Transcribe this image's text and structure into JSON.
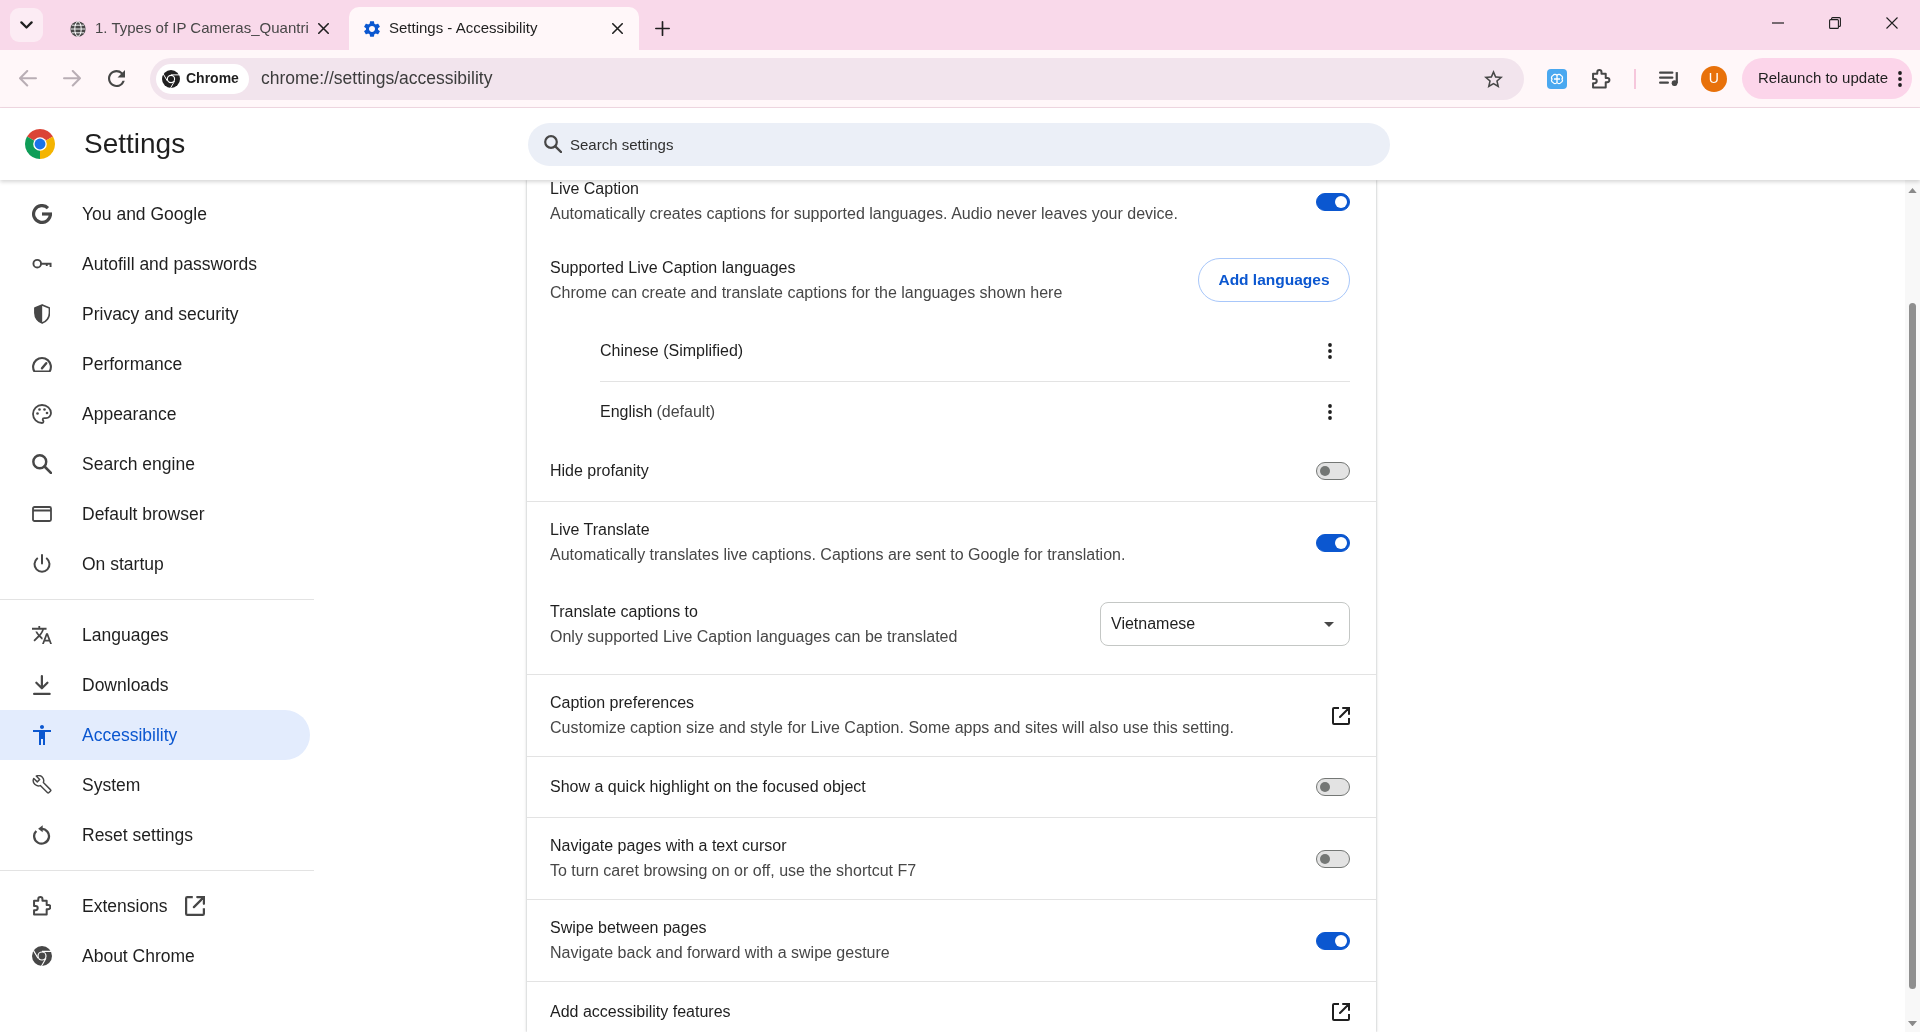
{
  "browser": {
    "tabs": [
      {
        "kind": "web",
        "title": "1. Types of IP Cameras_Quantri",
        "selected": false
      },
      {
        "kind": "settings",
        "title": "Settings - Accessibility",
        "selected": true
      }
    ],
    "toolbar": {
      "back_disabled": true,
      "forward_disabled": true,
      "site_chip": "Chrome",
      "url": "chrome://settings/accessibility",
      "avatar": "U",
      "relaunch_button": "Relaunch to update"
    }
  },
  "header": {
    "title": "Settings",
    "search": {
      "placeholder": "Search settings"
    }
  },
  "sidebar": {
    "groups": [
      {
        "items": [
          {
            "label": "You and Google",
            "selected": false,
            "external": false
          },
          {
            "label": "Autofill and passwords",
            "selected": false,
            "external": false
          },
          {
            "label": "Privacy and security",
            "selected": false,
            "external": false
          },
          {
            "label": "Performance",
            "selected": false,
            "external": false
          },
          {
            "label": "Appearance",
            "selected": false,
            "external": false
          },
          {
            "label": "Search engine",
            "selected": false,
            "external": false
          },
          {
            "label": "Default browser",
            "selected": false,
            "external": false
          },
          {
            "label": "On startup",
            "selected": false,
            "external": false
          }
        ]
      },
      {
        "items": [
          {
            "label": "Languages",
            "selected": false,
            "external": false
          },
          {
            "label": "Downloads",
            "selected": false,
            "external": false
          },
          {
            "label": "Accessibility",
            "selected": true,
            "external": false
          },
          {
            "label": "System",
            "selected": false,
            "external": false
          },
          {
            "label": "Reset settings",
            "selected": false,
            "external": false
          }
        ]
      },
      {
        "items": [
          {
            "label": "Extensions",
            "selected": false,
            "external": true
          },
          {
            "label": "About Chrome",
            "selected": false,
            "external": false
          }
        ]
      }
    ]
  },
  "content": {
    "sections": [
      {
        "rows": [
          {
            "kind": "toggle",
            "title": "Live Caption",
            "description": "Automatically creates captions for supported languages. Audio never leaves your device.",
            "on": true
          },
          {
            "kind": "languages",
            "title": "Supported Live Caption languages",
            "description": "Chrome can create and translate captions for the languages shown here",
            "button": "Add languages",
            "languages": [
              {
                "name": "Chinese (Simplified)"
              },
              {
                "name": "English",
                "note": "(default)"
              }
            ]
          },
          {
            "kind": "toggle",
            "title": "Hide profanity",
            "on": false
          }
        ]
      },
      {
        "rows": [
          {
            "kind": "toggle",
            "title": "Live Translate",
            "description": "Automatically translates live captions. Captions are sent to Google for translation.",
            "on": true
          },
          {
            "kind": "select",
            "title": "Translate captions to",
            "description": "Only supported Live Caption languages can be translated",
            "value": "Vietnamese"
          }
        ]
      },
      {
        "rows": [
          {
            "kind": "link",
            "title": "Caption preferences",
            "description": "Customize caption size and style for Live Caption. Some apps and sites will also use this setting."
          }
        ]
      },
      {
        "rows": [
          {
            "kind": "toggle",
            "title": "Show a quick highlight on the focused object",
            "on": false
          }
        ]
      },
      {
        "rows": [
          {
            "kind": "toggle",
            "title": "Navigate pages with a text cursor",
            "description": "To turn caret browsing on or off, use the shortcut F7",
            "on": false
          }
        ]
      },
      {
        "rows": [
          {
            "kind": "toggle",
            "title": "Swipe between pages",
            "description": "Navigate back and forward with a swipe gesture",
            "on": true
          }
        ]
      },
      {
        "rows": [
          {
            "kind": "link",
            "title": "Add accessibility features"
          }
        ]
      }
    ]
  }
}
